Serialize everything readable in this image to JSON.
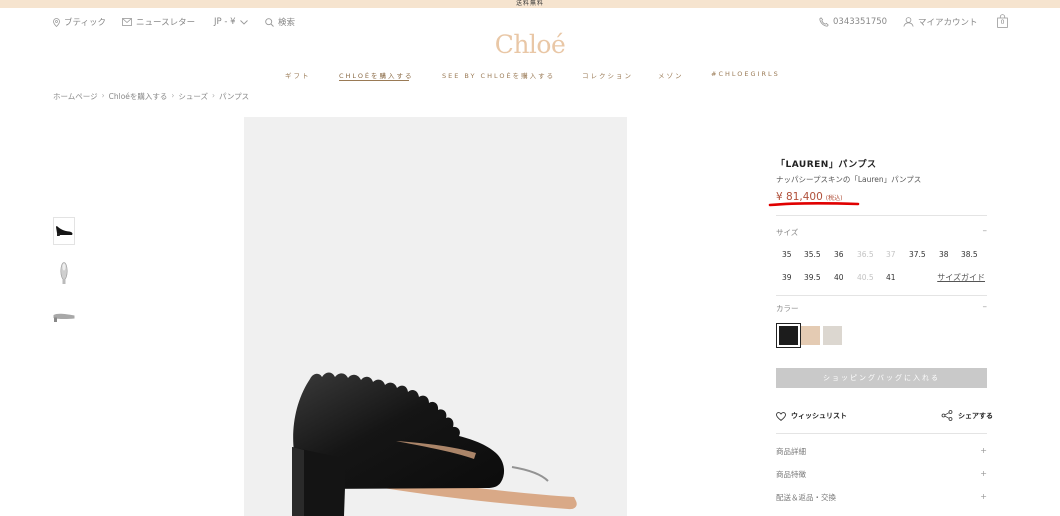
{
  "banner": {
    "text": "送料無料"
  },
  "utility": {
    "boutique": "ブティック",
    "newsletter": "ニュースレター",
    "locale": "JP - ¥",
    "search": "検索",
    "phone": "0343351750",
    "account": "マイアカウント",
    "bag_count": "0"
  },
  "brand": {
    "logo": "Chloé"
  },
  "nav": {
    "items": [
      {
        "label": "ギフト"
      },
      {
        "label": "CHLOÉを購入する"
      },
      {
        "label": "SEE BY CHLOÉを購入する"
      },
      {
        "label": "コレクション"
      },
      {
        "label": "メゾン"
      },
      {
        "label": "#CHLOEGIRLS"
      }
    ]
  },
  "breadcrumb": {
    "items": [
      "ホームページ",
      "Chloéを購入する",
      "シューズ",
      "パンプス"
    ],
    "separator": "›"
  },
  "product": {
    "title": "「LAUREN」パンプス",
    "subtitle": "ナッパシープスキンの「Lauren」パンプス",
    "price": "¥ 81,400",
    "tax_note": "(税込)",
    "size_label": "サイズ",
    "sizes_row1": [
      {
        "label": "35",
        "available": true
      },
      {
        "label": "35.5",
        "available": true
      },
      {
        "label": "36",
        "available": true
      },
      {
        "label": "36.5",
        "available": false
      },
      {
        "label": "37",
        "available": false
      },
      {
        "label": "37.5",
        "available": true
      },
      {
        "label": "38",
        "available": true
      },
      {
        "label": "38.5",
        "available": true
      }
    ],
    "sizes_row2": [
      {
        "label": "39",
        "available": true
      },
      {
        "label": "39.5",
        "available": true
      },
      {
        "label": "40",
        "available": true
      },
      {
        "label": "40.5",
        "available": false
      },
      {
        "label": "41",
        "available": true
      }
    ],
    "size_guide": "サイズガイド",
    "color_label": "カラー",
    "colors": [
      "#1c1c1c",
      "#e4cbb3",
      "#dcd7d0"
    ],
    "add_to_bag": "ショッピングバッグに入れる",
    "wishlist": "ウィッシュリスト",
    "share": "シェアする",
    "accordion": [
      "商品詳細",
      "商品特徴",
      "配送＆返品・交換"
    ],
    "toggle_minus": "–",
    "toggle_plus": "+"
  },
  "colors": {
    "accent": "#9a7a55",
    "logo": "#e9c7a6",
    "price": "#b0503a",
    "annotation": "#e00000"
  }
}
